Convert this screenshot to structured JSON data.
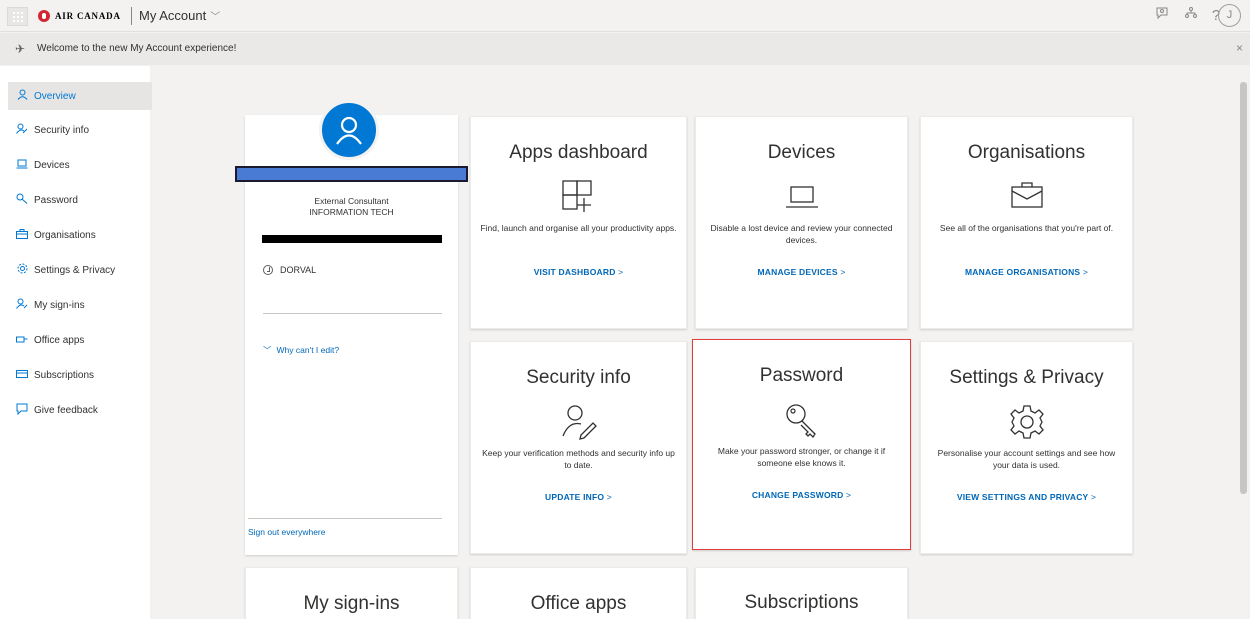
{
  "header": {
    "brand": "AIR CANADA",
    "app_title": "My Account",
    "icons": [
      "feedback-icon",
      "org-icon",
      "help-icon"
    ],
    "help_glyph": "?",
    "avatar_initial": "J"
  },
  "notice": {
    "message": "Welcome to the new My Account experience!",
    "close_glyph": "×"
  },
  "sidebar": {
    "items": [
      {
        "label": "Overview",
        "icon": "person-icon"
      },
      {
        "label": "Security info",
        "icon": "security-info-icon"
      },
      {
        "label": "Devices",
        "icon": "laptop-icon"
      },
      {
        "label": "Password",
        "icon": "key-icon"
      },
      {
        "label": "Organisations",
        "icon": "briefcase-icon"
      },
      {
        "label": "Settings & Privacy",
        "icon": "gear-icon"
      },
      {
        "label": "My sign-ins",
        "icon": "sign-ins-icon"
      },
      {
        "label": "Office apps",
        "icon": "office-apps-icon"
      },
      {
        "label": "Subscriptions",
        "icon": "subscriptions-icon"
      },
      {
        "label": "Give feedback",
        "icon": "feedback-icon"
      }
    ]
  },
  "profile": {
    "role": "External Consultant",
    "department": "INFORMATION TECH",
    "location": "DORVAL",
    "why_cant_edit": "Why can't I edit?",
    "sign_out_everywhere": "Sign out everywhere"
  },
  "cards": {
    "apps": {
      "title": "Apps dashboard",
      "desc": "Find, launch and organise all your productivity apps.",
      "link": "VISIT DASHBOARD"
    },
    "devices": {
      "title": "Devices",
      "desc": "Disable a lost device and review your connected devices.",
      "link": "MANAGE DEVICES"
    },
    "orgs": {
      "title": "Organisations",
      "desc": "See all of the organisations that you're part of.",
      "link": "MANAGE ORGANISATIONS"
    },
    "security": {
      "title": "Security info",
      "desc": "Keep your verification methods and security info up to date.",
      "link": "UPDATE INFO"
    },
    "password": {
      "title": "Password",
      "desc": "Make your password stronger, or change it if someone else knows it.",
      "link": "CHANGE PASSWORD"
    },
    "settings": {
      "title": "Settings & Privacy",
      "desc": "Personalise your account settings and see how your data is used.",
      "link": "VIEW SETTINGS AND PRIVACY"
    },
    "signins": {
      "title": "My sign-ins"
    },
    "office": {
      "title": "Office apps"
    },
    "subscriptions": {
      "title": "Subscriptions"
    }
  },
  "link_chevron": " >",
  "colors": {
    "accent": "#0078d4",
    "link": "#0067b8",
    "highlight": "#e03c3c",
    "brand_red": "#d22630"
  }
}
